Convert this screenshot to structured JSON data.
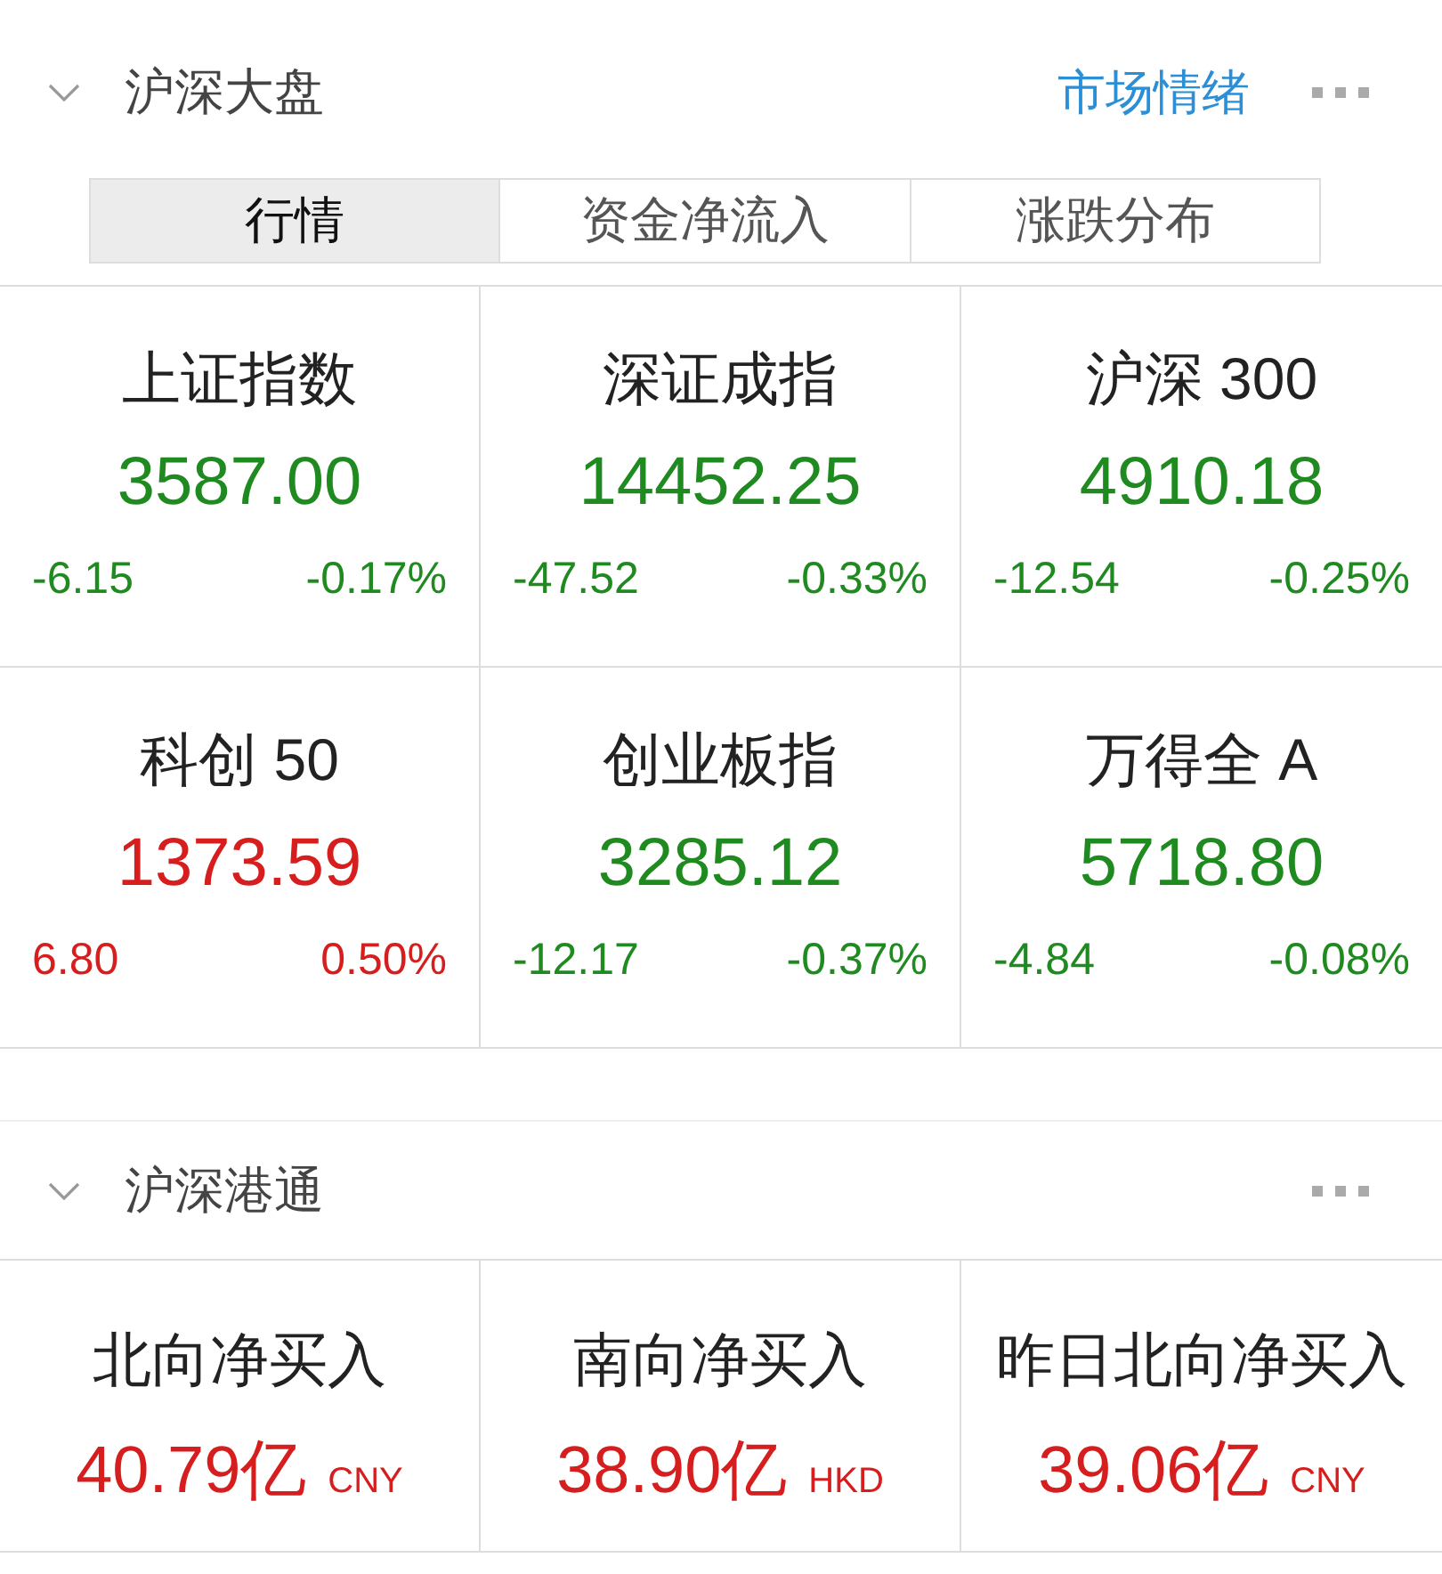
{
  "sections": [
    {
      "title": "沪深大盘",
      "expanded": true,
      "link": "市场情绪",
      "tabs": [
        {
          "label": "行情",
          "selected": true
        },
        {
          "label": "资金净流入",
          "selected": false
        },
        {
          "label": "涨跌分布",
          "selected": false
        }
      ],
      "indices": [
        {
          "name": "上证指数",
          "value": "3587.00",
          "change": "-6.15",
          "percent": "-0.17%",
          "color": "#1f8a1f"
        },
        {
          "name": "深证成指",
          "value": "14452.25",
          "change": "-47.52",
          "percent": "-0.33%",
          "color": "#1f8a1f"
        },
        {
          "name": "沪深 300",
          "value": "4910.18",
          "change": "-12.54",
          "percent": "-0.25%",
          "color": "#1f8a1f"
        },
        {
          "name": "科创 50",
          "value": "1373.59",
          "change": "6.80",
          "percent": "0.50%",
          "color": "#d71e1e"
        },
        {
          "name": "创业板指",
          "value": "3285.12",
          "change": "-12.17",
          "percent": "-0.37%",
          "color": "#1f8a1f"
        },
        {
          "name": "万得全 A",
          "value": "5718.80",
          "change": "-4.84",
          "percent": "-0.08%",
          "color": "#1f8a1f"
        }
      ]
    },
    {
      "title": "沪深港通",
      "expanded": true,
      "flows": [
        {
          "name": "北向净买入",
          "amount": "40.79亿",
          "currency": "CNY",
          "color": "#d71e1e"
        },
        {
          "name": "南向净买入",
          "amount": "38.90亿",
          "currency": "HKD",
          "color": "#d71e1e"
        },
        {
          "name": "昨日北向净买入",
          "amount": "39.06亿",
          "currency": "CNY",
          "color": "#d71e1e"
        }
      ]
    }
  ]
}
